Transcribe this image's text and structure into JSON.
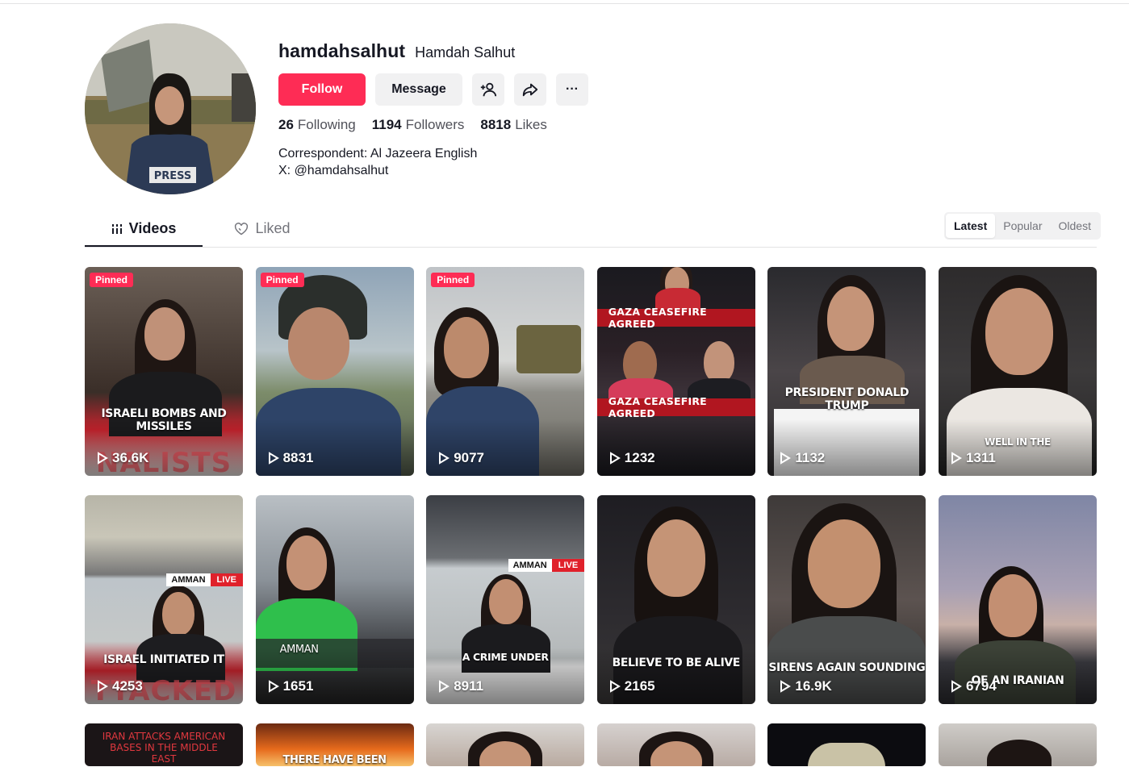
{
  "profile": {
    "username": "hamdahsalhut",
    "nickname": "Hamdah Salhut",
    "follow_label": "Follow",
    "message_label": "Message",
    "more_label": "···",
    "stats": {
      "following_count": "26",
      "following_label": "Following",
      "followers_count": "1194",
      "followers_label": "Followers",
      "likes_count": "8818",
      "likes_label": "Likes"
    },
    "bio_line1": "Correspondent: Al Jazeera English",
    "bio_line2": "X: @hamdahsalhut"
  },
  "tabs": {
    "videos": "Videos",
    "liked": "Liked"
  },
  "sort": {
    "latest": "Latest",
    "popular": "Popular",
    "oldest": "Oldest"
  },
  "pinned_label": "Pinned",
  "videos": [
    {
      "views": "36.6K",
      "caption": "ISRAELI BOMBS AND MISSILES"
    },
    {
      "views": "8831"
    },
    {
      "views": "9077"
    },
    {
      "views": "1232",
      "banner1": "GAZA CEASEFIRE AGREED",
      "banner2": "GAZA CEASEFIRE AGREED"
    },
    {
      "views": "1132",
      "caption": "PRESIDENT DONALD TRUMP"
    },
    {
      "views": "1311",
      "caption": "WELL IN THE"
    },
    {
      "views": "4253",
      "caption": "ISRAEL INITIATED IT",
      "city": "AMMAN",
      "live": "LIVE"
    },
    {
      "views": "1651",
      "caption": "AMMAN"
    },
    {
      "views": "8911",
      "caption": "A CRIME UNDER",
      "city": "AMMAN",
      "live": "LIVE"
    },
    {
      "views": "2165",
      "caption": "BELIEVE TO BE ALIVE"
    },
    {
      "views": "16.9K",
      "caption": "SIRENS AGAIN SOUNDING"
    },
    {
      "views": "6794",
      "caption": "OF AN IRANIAN"
    },
    {
      "caption": "IRAN ATTACKS AMERICAN BASES IN THE MIDDLE EAST"
    },
    {
      "caption": "THERE HAVE BEEN"
    },
    {},
    {},
    {},
    {}
  ]
}
